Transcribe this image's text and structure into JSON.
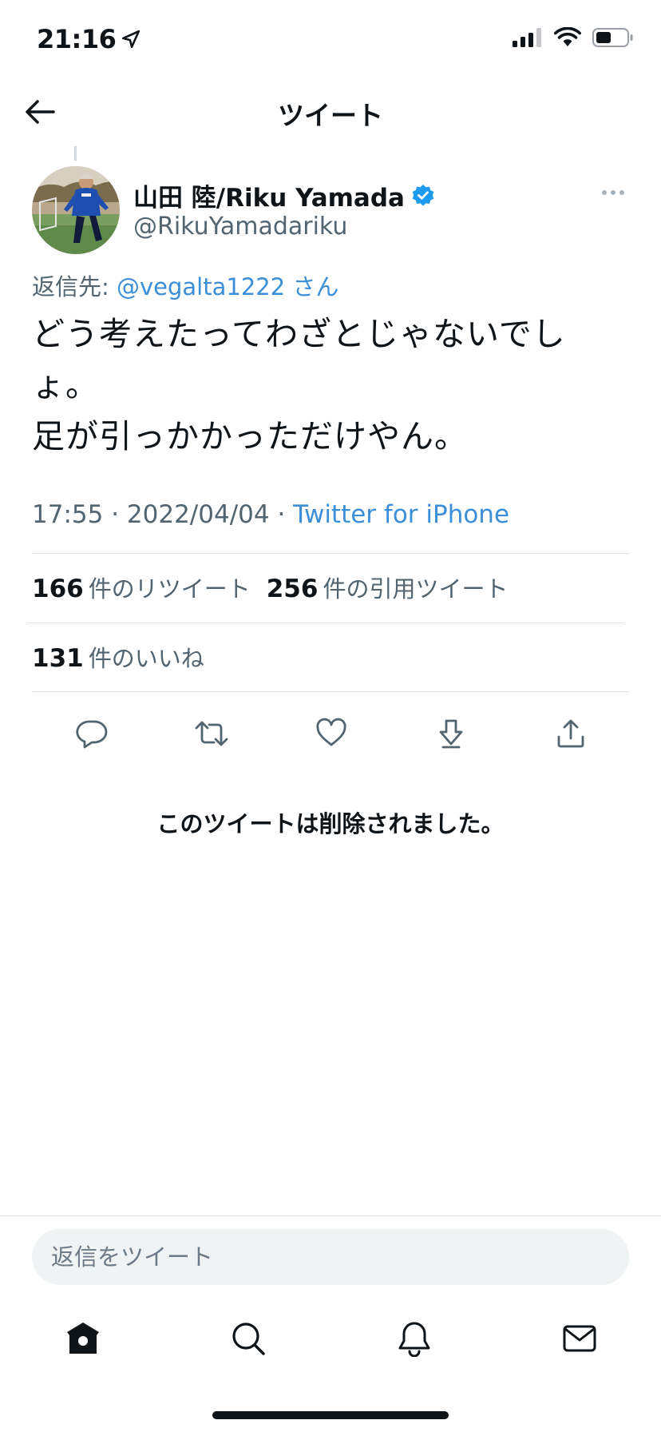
{
  "status_bar": {
    "time": "21:16"
  },
  "header": {
    "title": "ツイート"
  },
  "author": {
    "name": "山田 陸/Riku Yamada",
    "handle": "@RikuYamadariku"
  },
  "reply_to": {
    "prefix": "返信先:",
    "handle": "@vegalta1222",
    "suffix": "さん"
  },
  "tweet": {
    "text": "どう考えたってわざとじゃないでしょ。\n足が引っかかっただけやん。",
    "time": "17:55",
    "date": "2022/04/04",
    "source": "Twitter for iPhone"
  },
  "stats": {
    "retweets": {
      "count": "166",
      "label": "件のリツイート"
    },
    "quotes": {
      "count": "256",
      "label": "件の引用ツイート"
    },
    "likes": {
      "count": "131",
      "label": "件のいいね"
    }
  },
  "actions": [
    "reply-icon",
    "retweet-icon",
    "like-icon",
    "bookmark-icon",
    "share-icon"
  ],
  "deleted_message": "このツイートは削除されました。",
  "reply_box": {
    "placeholder": "返信をツイート"
  },
  "tabbar": [
    "home-icon",
    "search-icon",
    "notifications-icon",
    "messages-icon"
  ],
  "colors": {
    "accent": "#1d9bf0",
    "link": "#3b8fd9",
    "secondary_text": "#536471",
    "divider": "#dfe4e8"
  }
}
